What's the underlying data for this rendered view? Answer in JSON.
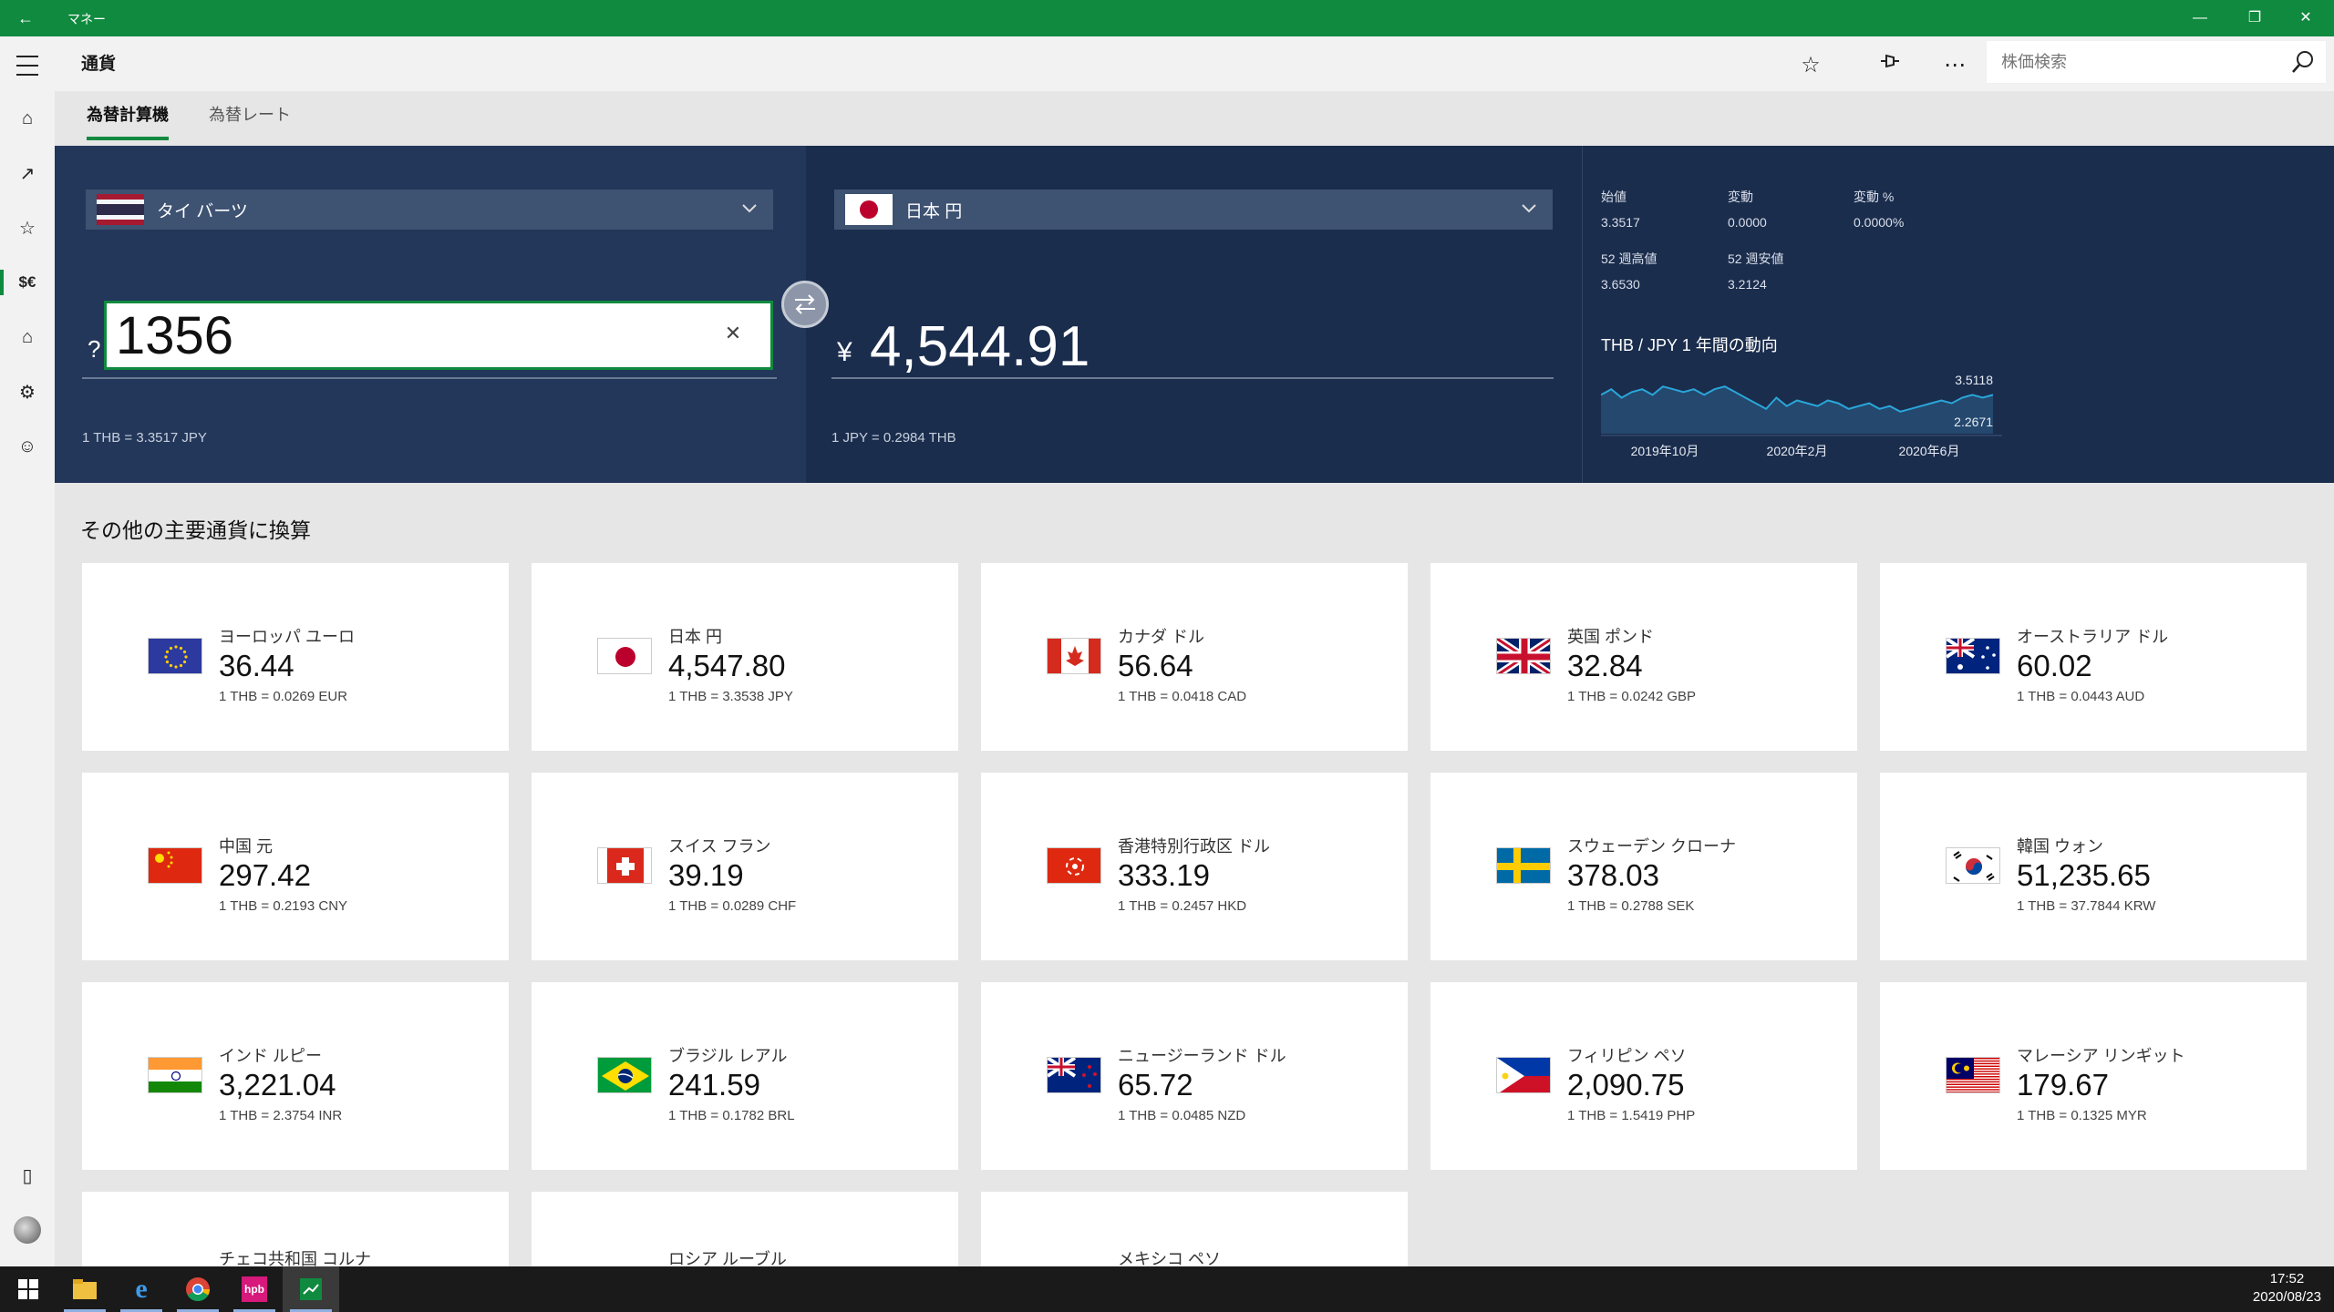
{
  "titlebar": {
    "title": "マネー",
    "back_icon": "back-arrow-icon"
  },
  "leftnav": {
    "items": [
      "menu-icon",
      "home-icon",
      "trending-icon",
      "watchlist-icon",
      "currency-icon",
      "mortgage-icon",
      "calculator-icon",
      "feedback-icon"
    ],
    "bottom": [
      "phone-icon",
      "avatar"
    ]
  },
  "header": {
    "title": "通貨",
    "search_placeholder": "株価検索"
  },
  "tabs": [
    {
      "label": "為替計算機",
      "active": true
    },
    {
      "label": "為替レート",
      "active": false
    }
  ],
  "converter": {
    "from": {
      "currency": "タイ バーツ",
      "amount": "1356",
      "prefix": "?",
      "rate_text": "1 THB  =  3.3517  JPY"
    },
    "to": {
      "currency": "日本 円",
      "symbol": "¥",
      "amount": "4,544.91",
      "rate_text": "1 JPY  =  0.2984  THB"
    },
    "stats": [
      {
        "label": "始値",
        "value": "3.3517"
      },
      {
        "label": "変動",
        "value": "0.0000"
      },
      {
        "label": "変動 %",
        "value": "0.0000%"
      },
      {
        "label": "52 週高値",
        "value": "3.6530"
      },
      {
        "label": "52 週安値",
        "value": "3.2124"
      }
    ]
  },
  "chart_data": {
    "type": "line",
    "title": "THB / JPY   1 年間の動向",
    "x": [
      "2019年10月",
      "2020年2月",
      "2020年6月"
    ],
    "y_labels": [
      "3.5118",
      "2.2671"
    ],
    "series": [
      {
        "values": [
          3.48,
          3.5,
          3.47,
          3.49,
          3.5,
          3.48,
          3.51,
          3.5,
          3.49,
          3.5,
          3.48,
          3.5,
          3.51,
          3.49,
          3.47,
          3.45,
          3.43,
          3.47,
          3.44,
          3.46,
          3.45,
          3.44,
          3.46,
          3.45,
          3.43,
          3.44,
          3.45,
          3.43,
          3.44,
          3.42,
          3.43,
          3.44,
          3.45,
          3.46,
          3.45,
          3.47,
          3.48,
          3.47,
          3.48
        ]
      }
    ],
    "color": "#2aa6d9"
  },
  "section_title": "その他の主要通貨に換算",
  "cards": [
    {
      "flag": "eu",
      "name": "ヨーロッパ ユーロ",
      "value": "36.44",
      "rate": "1 THB  =  0.0269  EUR"
    },
    {
      "flag": "jp",
      "name": "日本 円",
      "value": "4,547.80",
      "rate": "1 THB  =  3.3538  JPY"
    },
    {
      "flag": "ca",
      "name": "カナダ ドル",
      "value": "56.64",
      "rate": "1 THB  =  0.0418  CAD"
    },
    {
      "flag": "gb",
      "name": "英国 ポンド",
      "value": "32.84",
      "rate": "1 THB  =  0.0242  GBP"
    },
    {
      "flag": "au",
      "name": "オーストラリア ドル",
      "value": "60.02",
      "rate": "1 THB  =  0.0443  AUD"
    },
    {
      "flag": "cn",
      "name": "中国 元",
      "value": "297.42",
      "rate": "1 THB  =  0.2193  CNY"
    },
    {
      "flag": "ch",
      "name": "スイス フラン",
      "value": "39.19",
      "rate": "1 THB  =  0.0289  CHF"
    },
    {
      "flag": "hk",
      "name": "香港特別行政区 ドル",
      "value": "333.19",
      "rate": "1 THB  =  0.2457  HKD"
    },
    {
      "flag": "se",
      "name": "スウェーデン クローナ",
      "value": "378.03",
      "rate": "1 THB  =  0.2788  SEK"
    },
    {
      "flag": "kr",
      "name": "韓国 ウォン",
      "value": "51,235.65",
      "rate": "1 THB  =  37.7844  KRW"
    },
    {
      "flag": "in",
      "name": "インド ルピー",
      "value": "3,221.04",
      "rate": "1 THB  =  2.3754  INR"
    },
    {
      "flag": "br",
      "name": "ブラジル レアル",
      "value": "241.59",
      "rate": "1 THB  =  0.1782  BRL"
    },
    {
      "flag": "nz",
      "name": "ニュージーランド ドル",
      "value": "65.72",
      "rate": "1 THB  =  0.0485  NZD"
    },
    {
      "flag": "ph",
      "name": "フィリピン ペソ",
      "value": "2,090.75",
      "rate": "1 THB  =  1.5419  PHP"
    },
    {
      "flag": "my",
      "name": "マレーシア リンギット",
      "value": "179.67",
      "rate": "1 THB  =  0.1325  MYR"
    },
    {
      "flag": "cz",
      "name": "チェコ共和国 コルナ",
      "value": "",
      "rate": ""
    },
    {
      "flag": "ru",
      "name": "ロシア ルーブル",
      "value": "",
      "rate": ""
    },
    {
      "flag": "mx",
      "name": "メキシコ ペソ",
      "value": "",
      "rate": ""
    }
  ],
  "taskbar": {
    "apps": [
      "start-icon",
      "file-explorer-icon",
      "ie-icon",
      "chrome-icon",
      "hpb-icon",
      "money-app-icon"
    ],
    "time": "17:52",
    "date": "2020/08/23"
  }
}
